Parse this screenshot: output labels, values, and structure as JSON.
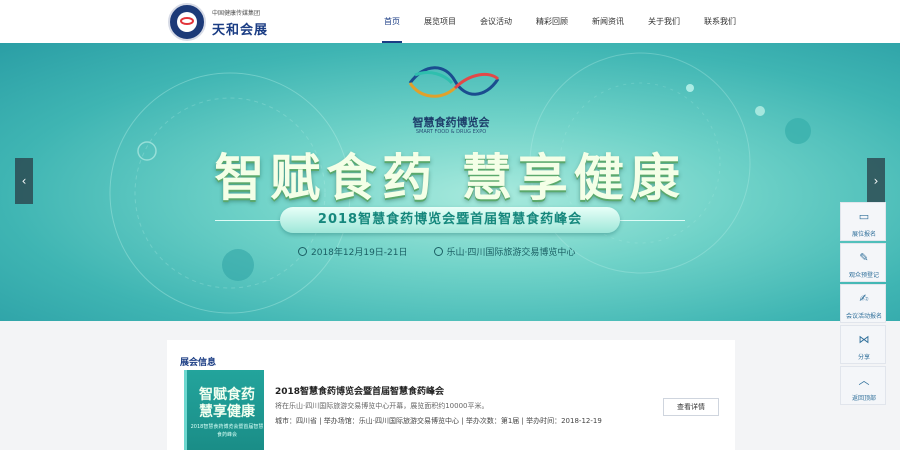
{
  "header": {
    "logo_group": "中国健康传媒集团",
    "logo_name": "天和会展",
    "nav": [
      {
        "label": "首页",
        "active": true
      },
      {
        "label": "展览项目"
      },
      {
        "label": "会议活动"
      },
      {
        "label": "精彩回顾"
      },
      {
        "label": "新闻资讯"
      },
      {
        "label": "关于我们"
      },
      {
        "label": "联系我们"
      }
    ]
  },
  "banner": {
    "expo_name": "智慧食药博览会",
    "expo_en": "SMART FOOD & DRUG EXPO",
    "slogan": "智赋食药  慧享健康",
    "event_title": "2018智慧食药博览会暨首届智慧食药峰会",
    "date": "2018年12月19日-21日",
    "venue": "乐山·四川国际旅游交易博览中心",
    "prev_arrow": "‹",
    "next_arrow": "›"
  },
  "card": {
    "section_title": "展会信息",
    "thumb_line1": "智赋食药",
    "thumb_line2": "慧享健康",
    "thumb_line3": "2018智慧食药博览会暨首届智慧食药峰会",
    "title": "2018智慧食药博览会暨首届智慧食药峰会",
    "desc": "将在乐山·四川国际旅游交易博览中心开幕，展览面积约10000平米。",
    "info": "城市：四川省 | 举办场馆：乐山·四川国际旅游交易博览中心 | 举办次数：第1届 | 举办时间：2018-12-19",
    "detail_button": "查看详情"
  },
  "sidebar": [
    {
      "label": "展位报名",
      "icon": "monitor-icon",
      "glyph": "▭"
    },
    {
      "label": "观众预登记",
      "icon": "edit-icon",
      "glyph": "✎"
    },
    {
      "label": "会议活动报名",
      "icon": "signup-icon",
      "glyph": "✍"
    },
    {
      "label": "分享",
      "icon": "share-icon",
      "glyph": "⋈"
    },
    {
      "label": "返回顶部",
      "icon": "chevron-up-icon",
      "glyph": "︿"
    }
  ],
  "colors": {
    "brand": "#1b3d84",
    "banner_teal": "#3fb5b3",
    "sidebar": "#2f6f9a"
  }
}
